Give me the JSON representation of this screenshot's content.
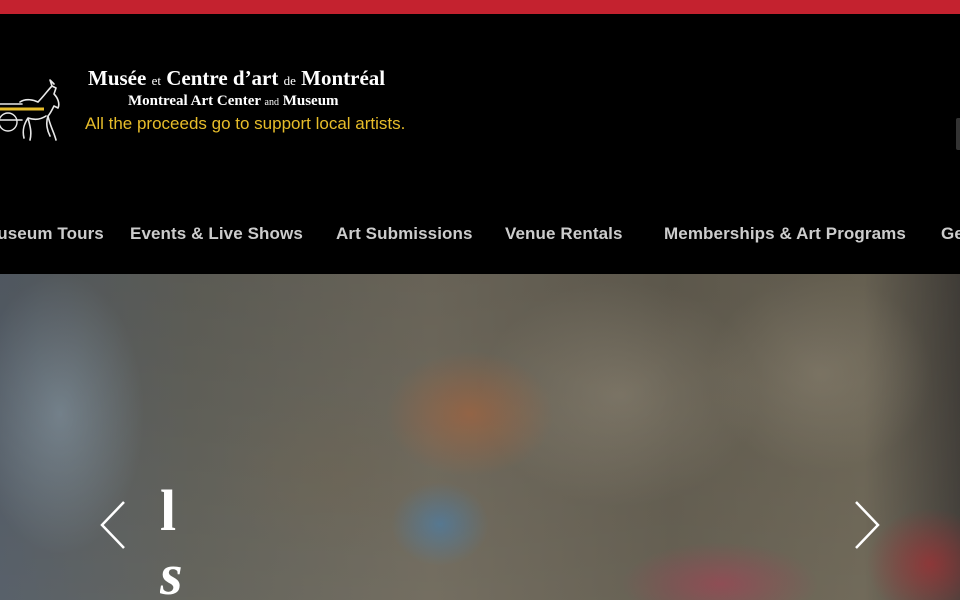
{
  "brand": {
    "title_part1": "Musée ",
    "title_et": "et",
    "title_part2": " Centre d’art ",
    "title_de": "de",
    "title_part3": " Montréal",
    "subtitle_part1": "Montreal Art Center ",
    "subtitle_and": "and",
    "subtitle_part2": " Museum",
    "tagline": "All the proceeds go to support local artists.",
    "accent_color": "#c4222f",
    "tagline_color": "#e7bd2a",
    "logo_icon": "horse-carriage-icon"
  },
  "nav": {
    "items": [
      {
        "label": "Museum Tours"
      },
      {
        "label": "Events & Live Shows"
      },
      {
        "label": "Art Submissions"
      },
      {
        "label": "Venue Rentals"
      },
      {
        "label": "Memberships & Art Programs"
      },
      {
        "label": "Ge"
      }
    ]
  },
  "hero": {
    "text_line1": "l",
    "text_line2": "s",
    "prev_icon": "chevron-left-icon",
    "next_icon": "chevron-right-icon"
  }
}
